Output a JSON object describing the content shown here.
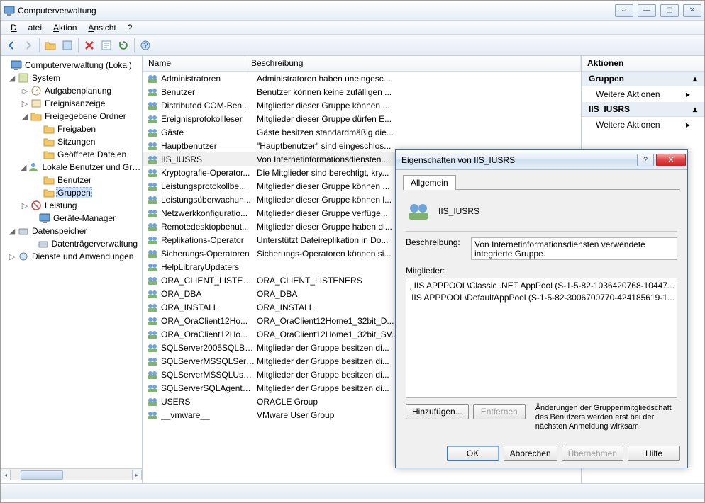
{
  "window": {
    "title": "Computerverwaltung"
  },
  "menu": {
    "file": "Datei",
    "action": "Aktion",
    "view": "Ansicht",
    "help": "?"
  },
  "tree": {
    "root": "Computerverwaltung (Lokal)",
    "system": "System",
    "taskscheduler": "Aufgabenplanung",
    "eventviewer": "Ereignisanzeige",
    "sharedfolders": "Freigegebene Ordner",
    "shares": "Freigaben",
    "sessions": "Sitzungen",
    "openfiles": "Geöffnete Dateien",
    "localusers": "Lokale Benutzer und Gr…",
    "users": "Benutzer",
    "groups": "Gruppen",
    "performance": "Leistung",
    "devmgr": "Geräte-Manager",
    "storage": "Datenspeicher",
    "diskmgmt": "Datenträgerverwaltung",
    "services": "Dienste und Anwendungen"
  },
  "columns": {
    "name": "Name",
    "desc": "Beschreibung"
  },
  "groups": [
    {
      "name": "Administratoren",
      "desc": "Administratoren haben uneingesc..."
    },
    {
      "name": "Benutzer",
      "desc": "Benutzer können keine zufälligen ..."
    },
    {
      "name": "Distributed COM-Ben...",
      "desc": "Mitglieder dieser Gruppe können ..."
    },
    {
      "name": "Ereignisprotokollleser",
      "desc": "Mitglieder dieser Gruppe dürfen E..."
    },
    {
      "name": "Gäste",
      "desc": "Gäste besitzen standardmäßig die..."
    },
    {
      "name": "Hauptbenutzer",
      "desc": "\"Hauptbenutzer\" sind eingeschlos..."
    },
    {
      "name": "IIS_IUSRS",
      "desc": "Von Internetinformationsdiensten..."
    },
    {
      "name": "Kryptografie-Operator...",
      "desc": "Die Mitglieder sind berechtigt, kry..."
    },
    {
      "name": "Leistungsprotokollbe...",
      "desc": "Mitglieder dieser Gruppe können ..."
    },
    {
      "name": "Leistungsüberwachun...",
      "desc": "Mitglieder dieser Gruppe können l..."
    },
    {
      "name": "Netzwerkkonfiguratio...",
      "desc": "Mitglieder dieser Gruppe verfüge..."
    },
    {
      "name": "Remotedesktopbenut...",
      "desc": "Mitglieder dieser Gruppe haben di..."
    },
    {
      "name": "Replikations-Operator",
      "desc": "Unterstützt Dateireplikation in Do..."
    },
    {
      "name": "Sicherungs-Operatoren",
      "desc": "Sicherungs-Operatoren können si..."
    },
    {
      "name": "HelpLibraryUpdaters",
      "desc": ""
    },
    {
      "name": "ORA_CLIENT_LISTENE...",
      "desc": "ORA_CLIENT_LISTENERS"
    },
    {
      "name": "ORA_DBA",
      "desc": "ORA_DBA"
    },
    {
      "name": "ORA_INSTALL",
      "desc": "ORA_INSTALL"
    },
    {
      "name": "ORA_OraClient12Ho...",
      "desc": "ORA_OraClient12Home1_32bit_D..."
    },
    {
      "name": "ORA_OraClient12Ho...",
      "desc": "ORA_OraClient12Home1_32bit_SV..."
    },
    {
      "name": "SQLServer2005SQLBro...",
      "desc": "Mitglieder der Gruppe besitzen di..."
    },
    {
      "name": "SQLServerMSSQLServ...",
      "desc": "Mitglieder der Gruppe besitzen di..."
    },
    {
      "name": "SQLServerMSSQLUser...",
      "desc": "Mitglieder der Gruppe besitzen di..."
    },
    {
      "name": "SQLServerSQLAgentU...",
      "desc": "Mitglieder der Gruppe besitzen di..."
    },
    {
      "name": "USERS",
      "desc": "ORACLE Group"
    },
    {
      "name": "__vmware__",
      "desc": "VMware User Group"
    }
  ],
  "actions": {
    "header": "Aktionen",
    "group1": "Gruppen",
    "more": "Weitere Aktionen",
    "group2": "IIS_IUSRS"
  },
  "dialog": {
    "title": "Eigenschaften von IIS_IUSRS",
    "tab": "Allgemein",
    "groupname": "IIS_IUSRS",
    "desc_label": "Beschreibung:",
    "desc_value": "Von Internetinformationsdiensten verwendete integrierte Gruppe.",
    "members_label": "Mitglieder:",
    "members": [
      "IIS APPPOOL\\Classic .NET AppPool (S-1-5-82-1036420768-10447...",
      "IIS APPPOOL\\DefaultAppPool (S-1-5-82-3006700770-424185619-1..."
    ],
    "add": "Hinzufügen...",
    "remove": "Entfernen",
    "note": "Änderungen der Gruppenmitgliedschaft des Benutzers werden erst bei der nächsten Anmeldung wirksam.",
    "ok": "OK",
    "cancel": "Abbrechen",
    "apply": "Übernehmen",
    "help": "Hilfe"
  }
}
